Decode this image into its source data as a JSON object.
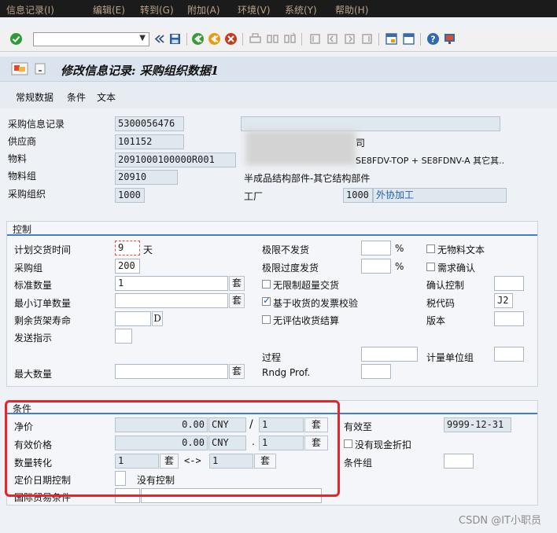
{
  "menu": [
    "信息记录(I)",
    "编辑(E)",
    "转到(G)",
    "附加(A)",
    "环境(V)",
    "系统(Y)",
    "帮助(H)"
  ],
  "toolbar": {
    "command_value": "",
    "icons": [
      "check-icon",
      "back-double-icon",
      "save-icon",
      "back-icon",
      "exit-icon",
      "cancel-icon",
      "print-icon",
      "find-icon",
      "find-next-icon",
      "first-page-icon",
      "prev-page-icon",
      "next-page-icon",
      "last-page-icon",
      "create-session-icon",
      "shortcut-icon",
      "help-icon",
      "customize-icon"
    ]
  },
  "title": "修改信息记录: 采购组织数据1",
  "app_buttons": [
    "常规数据",
    "条件",
    "文本"
  ],
  "header": {
    "labels": [
      "采购信息记录",
      "供应商",
      "物料",
      "物料组",
      "采购组织"
    ],
    "values": [
      "5300056476",
      "101152",
      "2091000100000R001",
      "20910",
      "1000"
    ],
    "vendor_name_tail": "司",
    "material_desc": "SE8FDV-TOP + SE8FDNV-A 其它其..",
    "material_group_desc": "半成品结构部件-其它结构部件",
    "plant_label": "工厂",
    "plant_value": "1000",
    "plant_desc": "外协加工"
  },
  "control": {
    "title": "控制",
    "planned_delivery_label": "计划交货时间",
    "planned_delivery_value": "9",
    "planned_delivery_unit": "天",
    "purch_group_label": "采购组",
    "purch_group_value": "200",
    "std_qty_label": "标准数量",
    "std_qty_value": "1",
    "min_qty_label": "最小订单数量",
    "remaining_shelf_label": "剩余货架寿命",
    "remaining_shelf_unit": "D",
    "shipping_instr_label": "发送指示",
    "max_qty_label": "最大数量",
    "uom": "套",
    "under_tol_label": "极限不发货",
    "over_tol_label": "极限过度发货",
    "percent": "%",
    "unlimited_label": "无限制超量交货",
    "gr_iv_label": "基于收货的发票校验",
    "no_eval_gr_label": "无评估收货结算",
    "process_label": "过程",
    "rndg_label": "Rndg Prof.",
    "no_mat_text_label": "无物料文本",
    "ack_req_label": "需求确认",
    "conf_ctrl_label": "确认控制",
    "tax_code_label": "税代码",
    "tax_code_value": "J2",
    "version_label": "版本",
    "uom_group_label": "计量单位组",
    "checks": {
      "no_mat_text": false,
      "ack_req": false,
      "unlimited": false,
      "gr_iv": true,
      "no_eval_gr": false
    }
  },
  "conditions": {
    "title": "条件",
    "net_price_label": "净价",
    "net_price_value": "0.00",
    "currency": "CNY",
    "slash": "/",
    "per_qty": "1",
    "uom": "套",
    "eff_price_label": "有效价格",
    "eff_price_value": "0.00",
    "eff_dot": ".",
    "qty_conv_label": "数量转化",
    "conv_from": "1",
    "conv_arrow": "<->",
    "conv_to": "1",
    "pricing_date_label": "定价日期控制",
    "pricing_date_text": "没有控制",
    "incoterms_label": "国际贸易条件",
    "valid_to_label": "有效至",
    "valid_to_value": "9999-12-31",
    "no_cash_disc_label": "没有现金折扣",
    "cond_group_label": "条件组",
    "no_cash_disc_checked": false
  },
  "watermark": "CSDN @IT小职员",
  "colors": {
    "highlight": "#e8232a",
    "group_line": "#3d7fc9"
  }
}
